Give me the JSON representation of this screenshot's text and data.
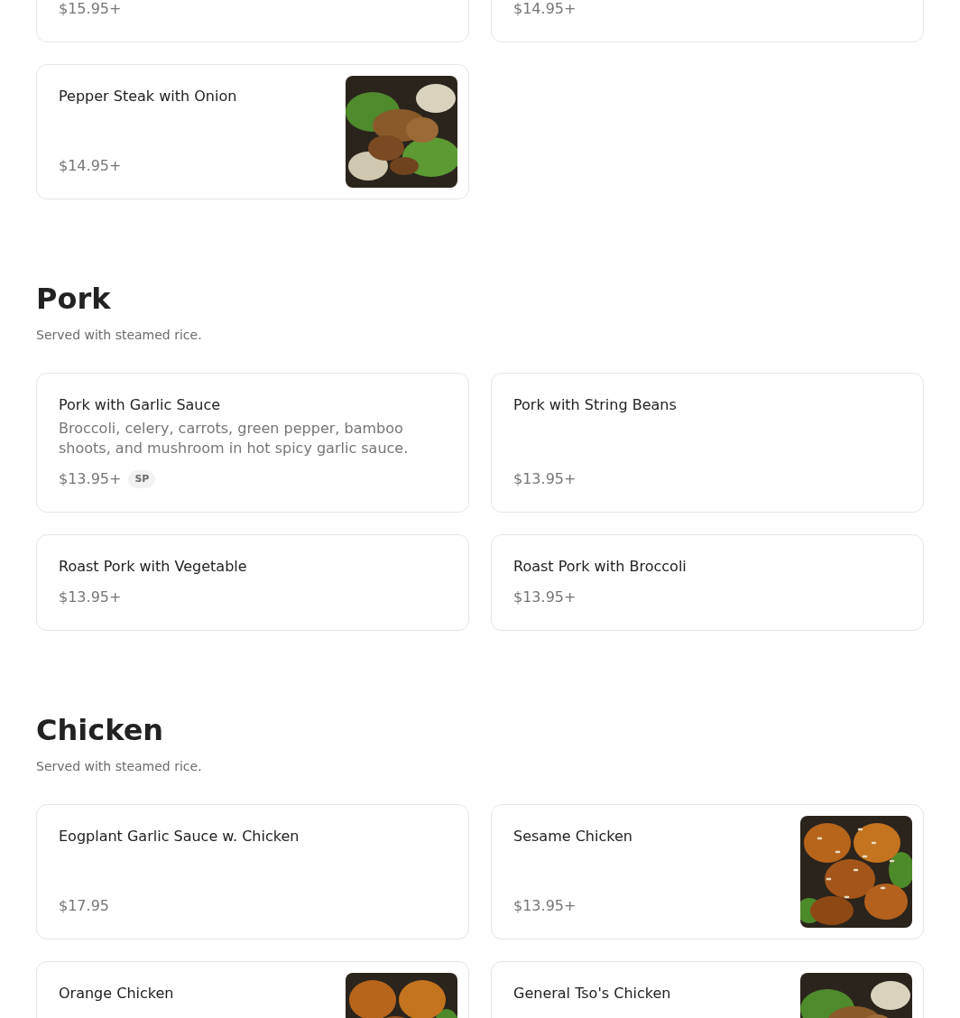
{
  "sections": [
    {
      "items": [
        {
          "price": "$15.95+"
        },
        {
          "price": "$14.95+"
        },
        {
          "name": "Pepper Steak with Onion",
          "price": "$14.95+"
        }
      ]
    },
    {
      "title": "Pork",
      "note": "Served with steamed rice.",
      "items": [
        {
          "name": "Pork with Garlic Sauce",
          "description": "Broccoli, celery, carrots, green pepper, bamboo shoots, and mushroom in hot spicy garlic sauce.",
          "price": "$13.95+",
          "tags": [
            "SP"
          ]
        },
        {
          "name": "Pork with String Beans",
          "price": "$13.95+"
        },
        {
          "name": "Roast Pork with Vegetable",
          "price": "$13.95+"
        },
        {
          "name": "Roast Pork with Broccoli",
          "price": "$13.95+"
        }
      ]
    },
    {
      "title": "Chicken",
      "note": "Served with steamed rice.",
      "items": [
        {
          "name": "Eogplant Garlic Sauce w. Chicken",
          "price": "$17.95"
        },
        {
          "name": "Sesame Chicken",
          "price": "$13.95+"
        },
        {
          "name": "Orange Chicken"
        },
        {
          "name": "General Tso's Chicken"
        }
      ]
    }
  ]
}
